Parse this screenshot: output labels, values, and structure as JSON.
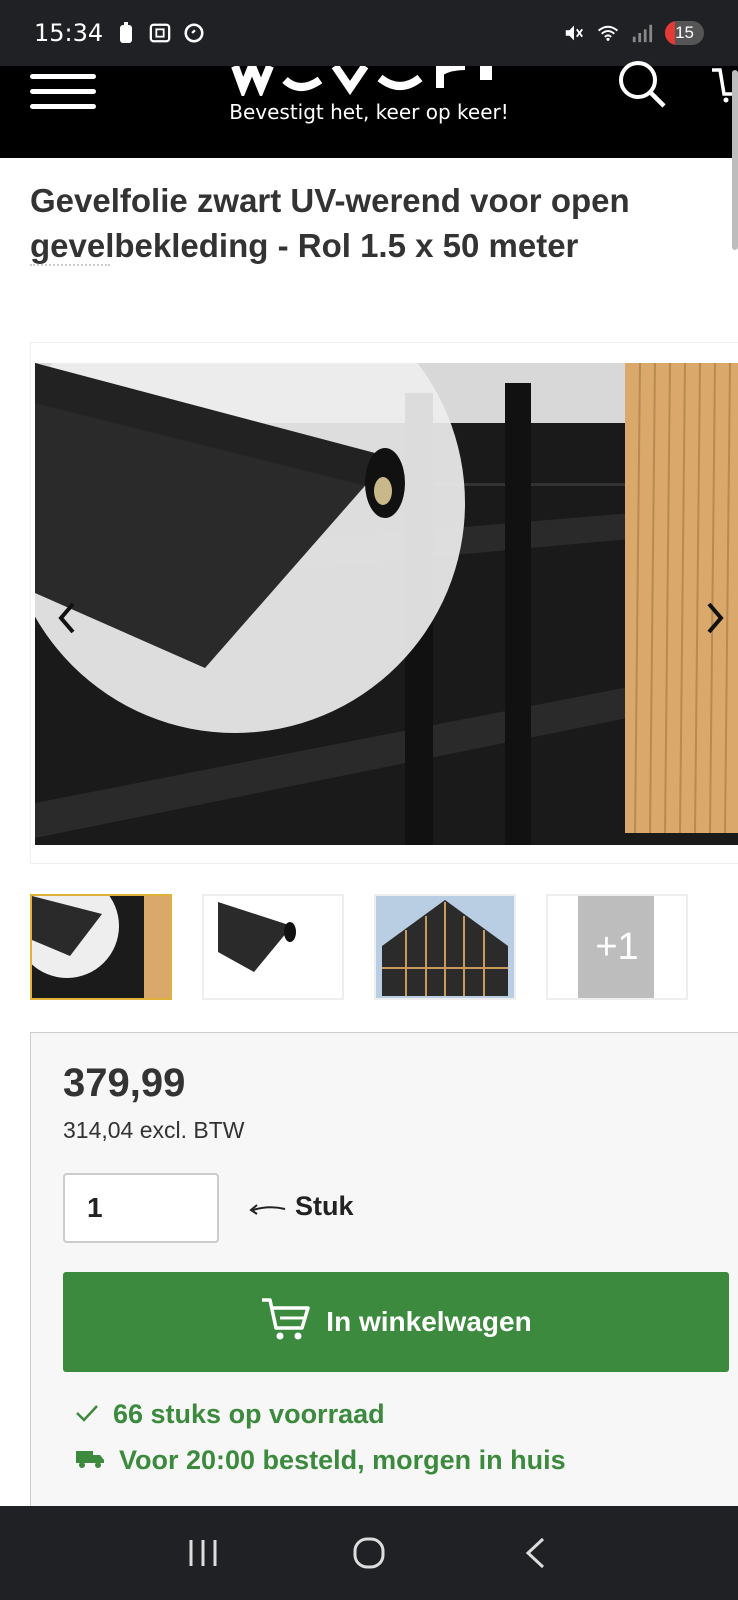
{
  "status_bar": {
    "time": "15:34",
    "battery": "15"
  },
  "header": {
    "tagline": "Bevestigt het, keer op keer!"
  },
  "product": {
    "title": "Gevelfolie zwart UV-werend voor open gevelbekleding - Rol 1.5 x 50 meter"
  },
  "gallery": {
    "thumbnails_more": "+1"
  },
  "buy_box": {
    "price": "379,99",
    "price_excl": "314,04 excl. BTW",
    "quantity_value": "1",
    "unit_label": "Stuk",
    "add_to_cart_label": "In winkelwagen",
    "stock_text": "66 stuks op voorraad",
    "delivery_text": "Voor 20:00 besteld, morgen in huis"
  },
  "colors": {
    "accent_green": "#3c8a3d",
    "thumb_active_border": "#e0b23a",
    "header_bg": "#000000"
  }
}
